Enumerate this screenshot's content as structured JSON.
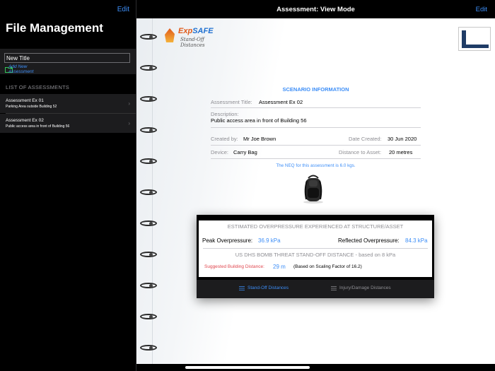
{
  "left_pane": {
    "edit_label": "Edit",
    "title": "File Management",
    "new_title_value": "New Title",
    "add_new_label": "Add New Assessment",
    "list_header": "LIST OF ASSESSMENTS",
    "items": [
      {
        "title": "Assessment Ex 01",
        "subtitle": "Parking Area outside Building 52"
      },
      {
        "title": "Assessment Ex 02",
        "subtitle": "Public access area in front of Building 56"
      }
    ]
  },
  "right_nav": {
    "title": "Assessment: View Mode",
    "edit_label": "Edit"
  },
  "logo": {
    "brand_prefix": "Exp",
    "brand_suffix": "SAFE",
    "subtitle": "Stand-Off Distances"
  },
  "scenario": {
    "heading": "SCENARIO INFORMATION",
    "title_label": "Assessment Title:",
    "title_value": "Assessment Ex 02",
    "description_label": "Description:",
    "description_value": "Public access area in front of Building 56",
    "created_by_label": "Created by:",
    "created_by_value": "Mr Joe Brown",
    "date_label": "Date Created:",
    "date_value": "30 Jun 2020",
    "device_label": "Device:",
    "device_value": "Carry Bag",
    "distance_label": "Distance to Asset:",
    "distance_value": "20 metres",
    "neq_note": "The NEQ for this assessment is 6.0 kgs."
  },
  "results": {
    "heading": "ESTIMATED OVERPRESSURE EXPERIENCED AT STRUCTURE/ASSET",
    "peak_label": "Peak Overpressure:",
    "peak_value": "36.9 kPa",
    "reflected_label": "Reflected Overpressure:",
    "reflected_value": "84.3 kPa",
    "dhs_heading": "US DHS BOMB THREAT STAND-OFF DISTANCE - based on 8 kPa",
    "suggested_label": "Suggested Building Distance:",
    "suggested_value": "29 m",
    "scaling_note": "(Based on Scaling Factor of 16.2)"
  },
  "tabs": [
    {
      "label": "Stand-Off Distances",
      "active": true
    },
    {
      "label": "Injury/Damage Distances",
      "active": false
    }
  ],
  "colors": {
    "accent": "#3d8ef7",
    "warning": "#e0464e",
    "background_dark": "#000000",
    "panel_dark": "#1c1c1e"
  }
}
